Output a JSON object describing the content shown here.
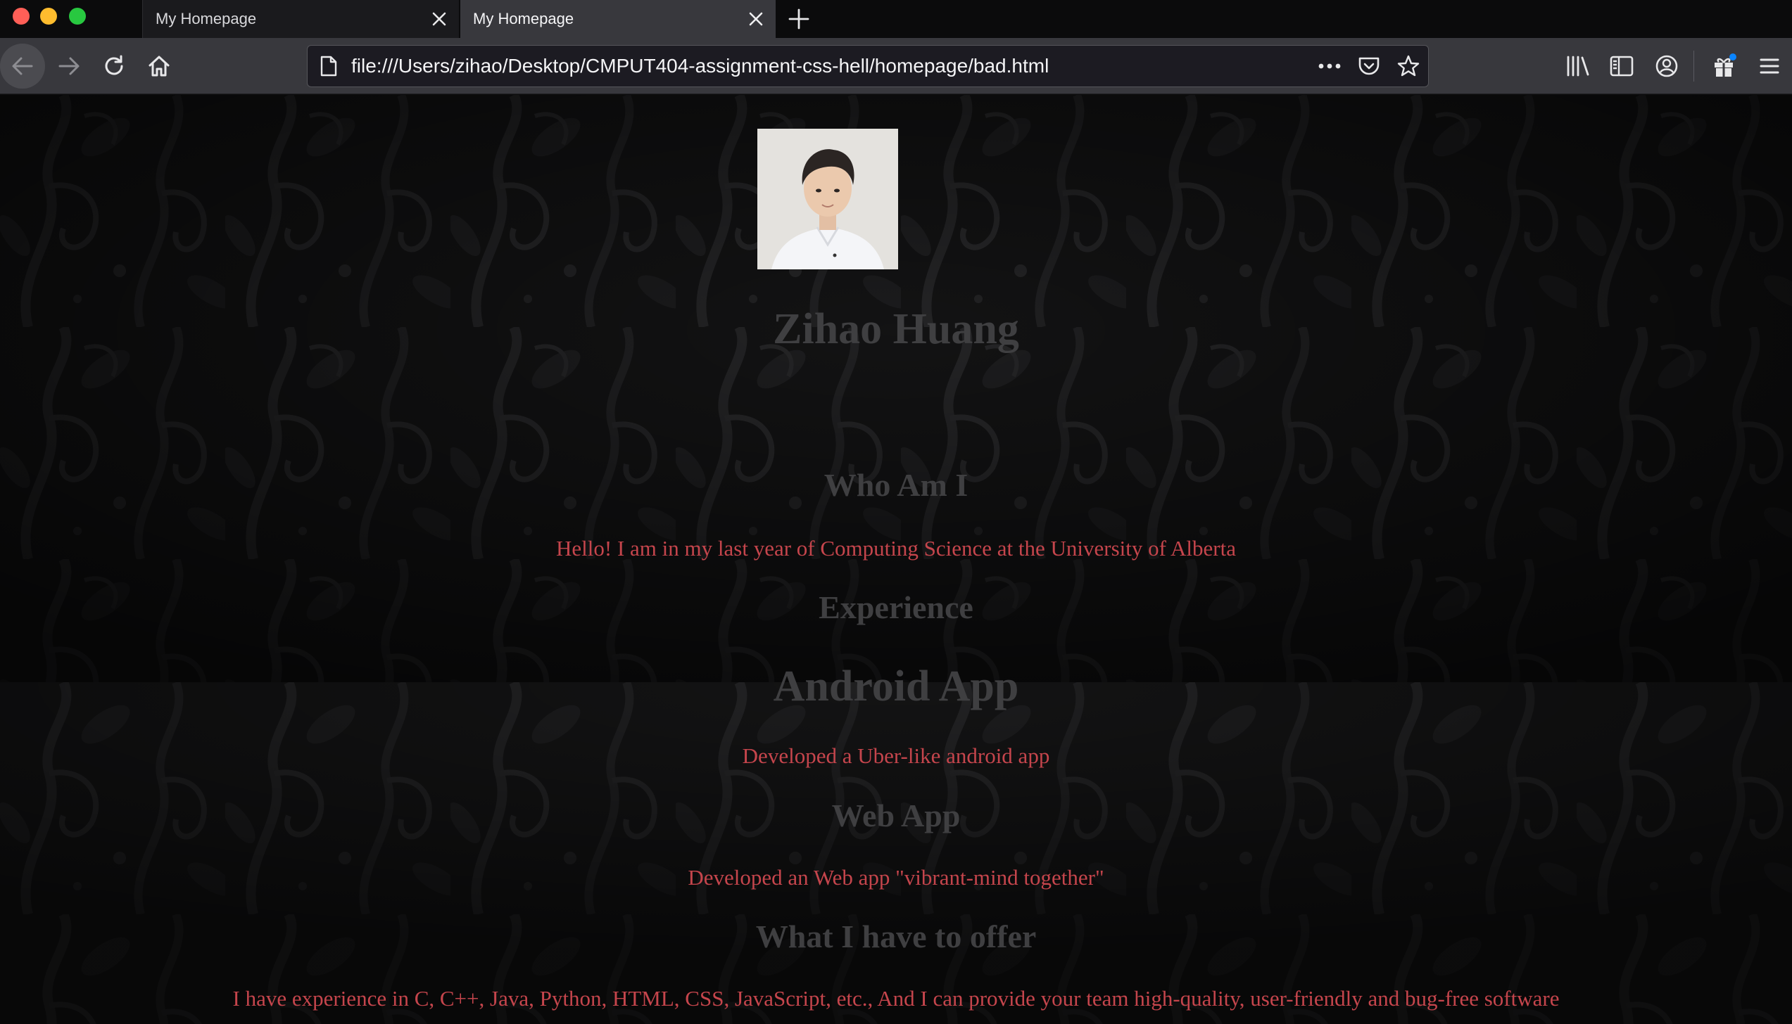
{
  "browser": {
    "tabs": [
      {
        "title": "My Homepage",
        "active": false
      },
      {
        "title": "My Homepage",
        "active": true
      }
    ],
    "url": "file:///Users/zihao/Desktop/CMPUT404-assignment-css-hell/homepage/bad.html",
    "icons": {
      "back": "back-arrow-icon",
      "forward": "forward-arrow-icon",
      "reload": "reload-icon",
      "home": "home-icon",
      "page": "page-icon",
      "more": "more-icon",
      "pocket": "pocket-icon",
      "bookmark": "star-icon",
      "library": "library-icon",
      "sidebar": "sidebar-icon",
      "account": "account-icon",
      "extensions": "gift-icon",
      "menu": "hamburger-menu-icon"
    },
    "colors": {
      "tabbar": "#0b0b0c",
      "navbar": "#38383d",
      "urlbar": "#1c1b22"
    }
  },
  "page": {
    "name": "Zihao Huang",
    "who_heading": "Who Am I",
    "who_text": "Hello! I am in my last year of Computing Science at the University of Alberta",
    "experience_heading": "Experience",
    "android_heading": "Android App",
    "android_text": "Developed a Uber-like android app",
    "web_heading": "Web App",
    "web_text": "Developed an Web app \"vibrant-mind together\"",
    "offer_heading": "What I have to offer",
    "offer_text": "I have experience in C, C++, Java, Python, HTML, CSS, JavaScript, etc., And I can provide your team high-quality, user-friendly and bug-free software",
    "colors": {
      "heading": "#3f3f41",
      "paragraph": "#c5454c",
      "background": "#101011"
    }
  }
}
